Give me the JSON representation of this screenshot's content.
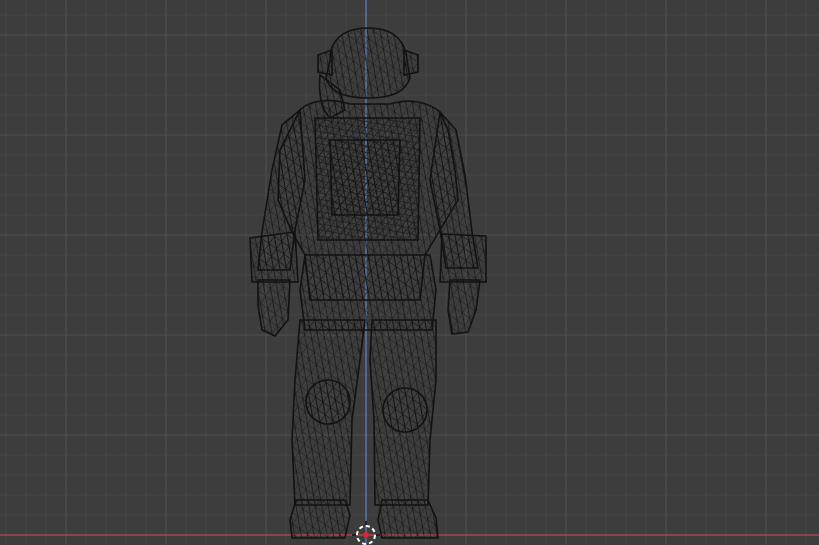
{
  "viewport": {
    "view": "front-orthographic",
    "shading": "wireframe",
    "background_color": "#3d3d3d",
    "grid_minor_color": "#454545",
    "grid_major_color": "#4f4f4f",
    "z_axis_color": "#5b86c9",
    "x_axis_color": "#c0474e",
    "wire_color": "#121212",
    "cursor_outer_color": "#ffffff",
    "cursor_inner_color": "#e0232c"
  },
  "model": {
    "subject": "astronaut-spacesuit",
    "display": "wireframe",
    "parts": [
      "helmet",
      "backpack",
      "torso",
      "left-arm",
      "right-arm",
      "left-glove",
      "right-glove",
      "pelvis",
      "left-leg",
      "right-leg",
      "left-boot",
      "right-boot"
    ]
  },
  "cursor": {
    "icon": "3d-cursor-icon"
  }
}
